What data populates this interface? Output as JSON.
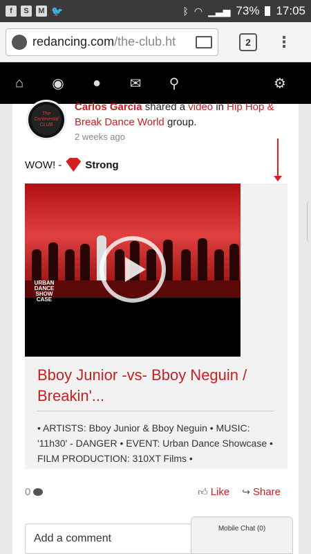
{
  "status_bar": {
    "battery": "73%",
    "time": "17:05"
  },
  "browser": {
    "url_domain": "redancing.com",
    "url_path": "/the-club.ht",
    "tab_count": "2"
  },
  "post": {
    "author": "Carlos Garcia",
    "shared_text": "shared a",
    "video_link": "video",
    "in_text": "in",
    "group_link": "Hip Hop & Break Dance World",
    "group_suffix": "group.",
    "time": "2 weeks ago",
    "status_prefix": "WOW! -",
    "status_word": "Strong",
    "avatar_text": "The Continental CLUB",
    "video_title": "Bboy Junior -vs- Bboy Neguin / Breakin'...",
    "video_desc": "• ARTISTS: Bboy Junior & Bboy Neguin • MUSIC: '11h30' - DANGER • EVENT: Urban Dance Showcase • FILM PRODUCTION: 310XT Films •",
    "video_logo": "URBAN DANCE SHOW CASE",
    "comment_count": "0",
    "like_label": "Like",
    "share_label": "Share"
  },
  "comment": {
    "placeholder": "Add a comment"
  },
  "chat": {
    "label": "Mobile Chat (0)"
  },
  "colors": {
    "accent": "#c82020",
    "nav_bg": "#000000",
    "status_bg": "#3a3a3a"
  },
  "icons": {
    "nav": [
      "home-icon",
      "globe-icon",
      "user-icon",
      "mail-icon",
      "search-icon",
      "gear-icon"
    ]
  }
}
